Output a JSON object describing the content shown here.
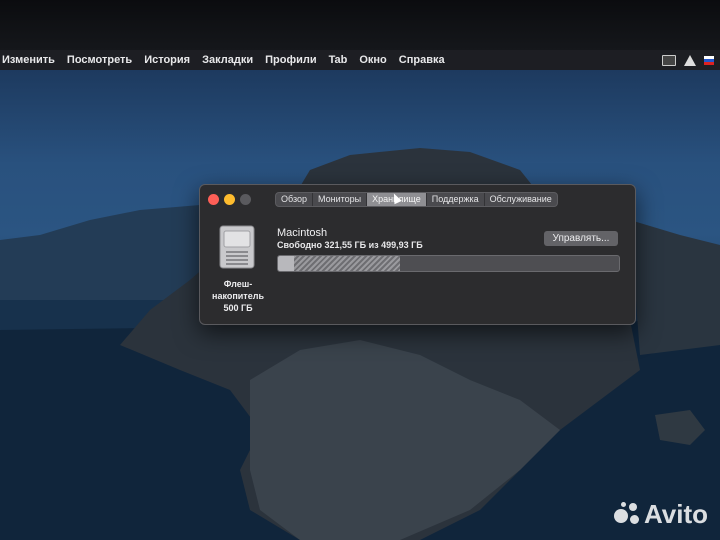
{
  "menubar": {
    "items": [
      "Изменить",
      "Посмотреть",
      "История",
      "Закладки",
      "Профили",
      "Tab",
      "Окно",
      "Справка"
    ],
    "tray_icons": [
      "keyboard-icon",
      "vlc-icon",
      "flag-icon"
    ]
  },
  "window": {
    "tabs": [
      {
        "label": "Обзор",
        "active": false
      },
      {
        "label": "Мониторы",
        "active": false
      },
      {
        "label": "Хранилище",
        "active": true
      },
      {
        "label": "Поддержка",
        "active": false
      },
      {
        "label": "Обслуживание",
        "active": false
      }
    ],
    "drive": {
      "icon": "drive-icon",
      "caption_line1": "Флеш-",
      "caption_line2": "накопитель",
      "caption_line3": "500 ГБ"
    },
    "volume": {
      "name": "Macintosh",
      "free_text": "Свободно 321,55 ГБ из 499,93 ГБ",
      "used_fraction": 0.357
    },
    "manage_label": "Управлять..."
  },
  "watermark": {
    "text": "Avito"
  },
  "colors": {
    "close": "#fe5f57",
    "minimize": "#febc2e",
    "zoom": "#5a5a5e"
  }
}
